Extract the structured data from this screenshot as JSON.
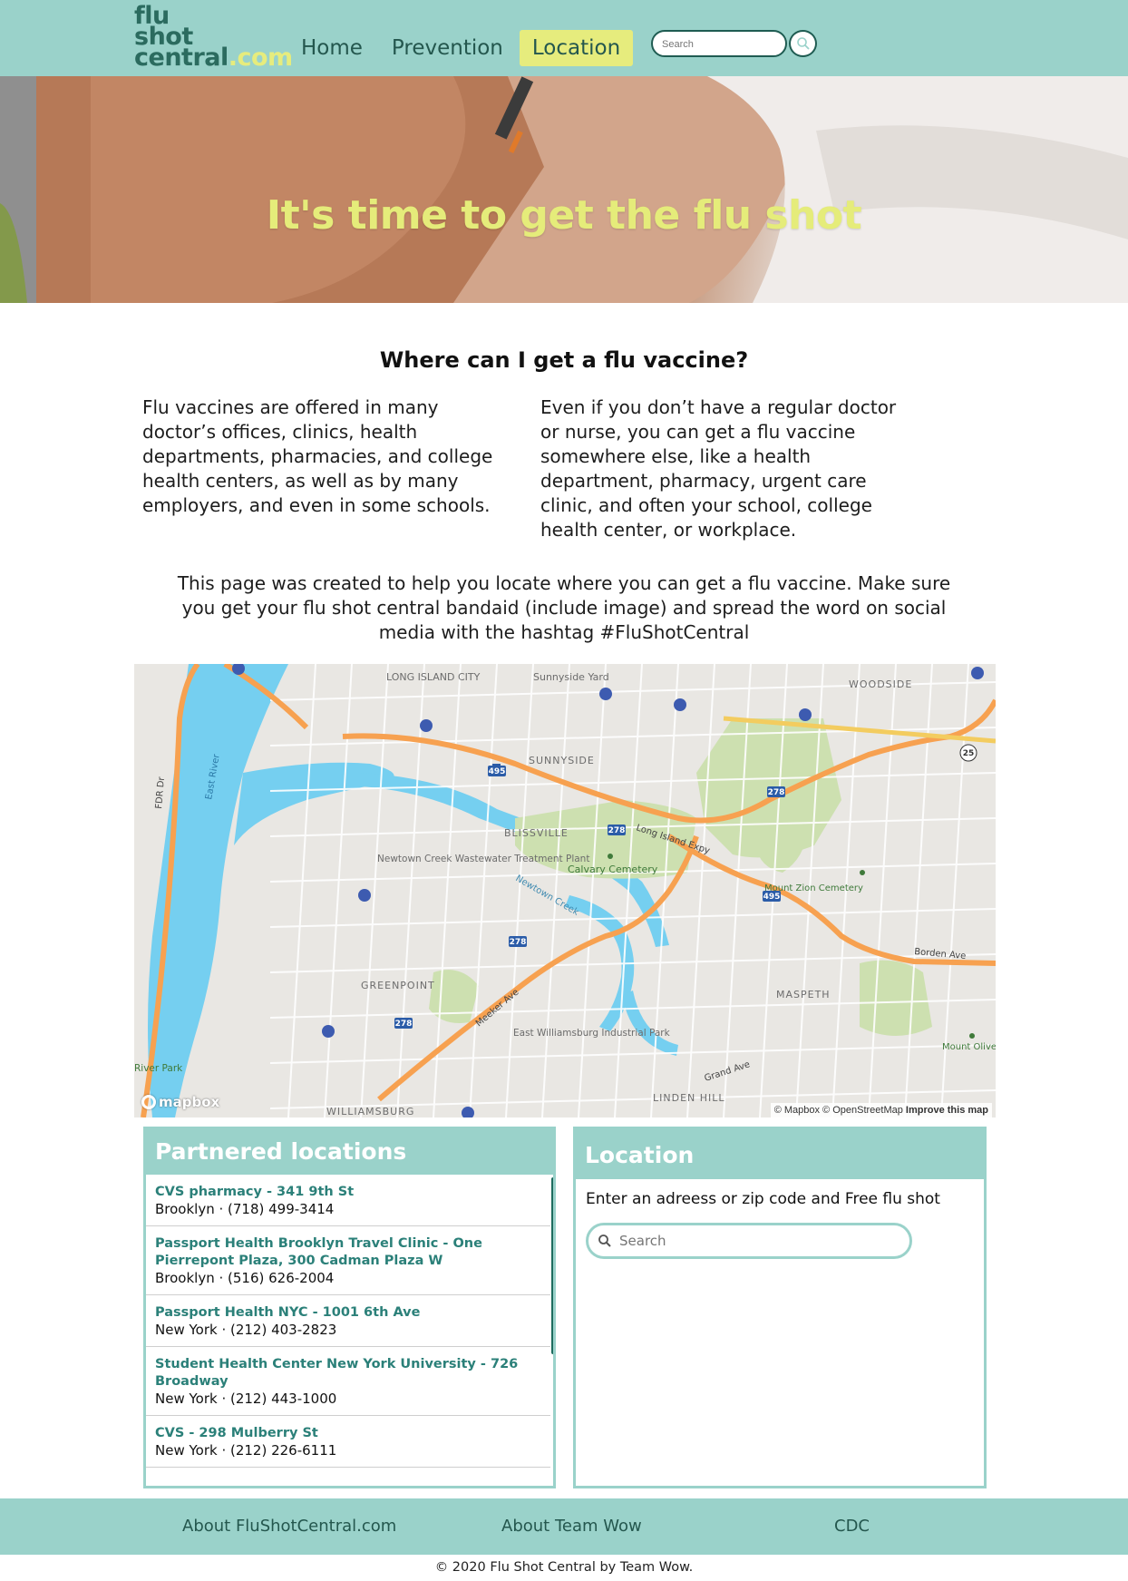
{
  "header": {
    "logo_line1": "flu",
    "logo_line2": "shot",
    "logo_line3": "central",
    "logo_suffix": ".com",
    "nav": [
      {
        "label": "Home"
      },
      {
        "label": "Prevention"
      },
      {
        "label": "Location",
        "active": true
      }
    ],
    "search_placeholder": "Search",
    "search_icon": "magnifier-icon"
  },
  "hero": {
    "title": "It's time to get the flu shot"
  },
  "main": {
    "section_title": "Where can I get a flu vaccine?",
    "col_left": "Flu vaccines are offered in many doctor’s offices, clinics, health departments, pharmacies, and college health centers, as well as by many employers, and even in some schools.",
    "col_right": "Even if you don’t have a regular doctor or nurse, you can get a flu vaccine somewhere else, like a health department, pharmacy, urgent care clinic, and often your school, college health center, or workplace.",
    "intro": "This page was created to help you locate where you can get a flu vaccine. Make sure you get your flu shot central bandaid (include image) and spread the word on social media with the hashtag #FluShotCentral"
  },
  "map": {
    "logo": "mapbox",
    "attribution": "© Mapbox © OpenStreetMap",
    "improve": "Improve this map",
    "labels": {
      "lic": "LONG ISLAND CITY",
      "sunnyside_yard": "Sunnyside Yard",
      "woodside": "WOODSIDE",
      "sunnyside": "SUNNYSIDE",
      "blissville": "BLISSVILLE",
      "newtown": "Newtown Creek Wastewater Treatment Plant",
      "calvary": "Calvary Cemetery",
      "mount_zion": "Mount Zion Cemetery",
      "greenpoint": "GREENPOINT",
      "maspeth": "MASPETH",
      "ewip": "East Williamsburg Industrial Park",
      "linden_hill": "LINDEN HILL",
      "williamsburg": "WILLIAMSBURG",
      "east_river": "East River",
      "river_park": "River Park",
      "mount_olivet": "Mount Olivet Cemetery",
      "lie": "Long Island Expy",
      "newtown_creek": "Newtown Creek",
      "meeker": "Meeker Ave",
      "fdr": "FDR Dr",
      "borden": "Borden Ave",
      "grand": "Grand Ave",
      "shields": [
        "495",
        "278",
        "278",
        "278",
        "495",
        "278",
        "25"
      ]
    }
  },
  "partnered": {
    "title": "Partnered locations",
    "items": [
      {
        "name": "CVS pharmacy - 341 9th St",
        "meta": "Brooklyn · (718) 499-3414"
      },
      {
        "name": "Passport Health Brooklyn Travel Clinic - One Pierrepont Plaza, 300 Cadman Plaza W",
        "meta": "Brooklyn · (516) 626-2004"
      },
      {
        "name": "Passport Health NYC - 1001 6th Ave",
        "meta": "New York · (212) 403-2823"
      },
      {
        "name": "Student Health Center New York University - 726 Broadway",
        "meta": "New York · (212) 443-1000"
      },
      {
        "name": "CVS - 298 Mulberry St",
        "meta": "New York · (212) 226-6111"
      }
    ]
  },
  "location": {
    "title": "Location",
    "prompt": "Enter an adreess or zip code and Free flu shot",
    "search_placeholder": "Search"
  },
  "footer": {
    "links": [
      "About FluShotCentral.com",
      "About Team Wow",
      "CDC"
    ],
    "copyright": "© 2020 Flu Shot Central by Team Wow."
  },
  "colors": {
    "brand_teal": "#9ad2ca",
    "accent_yellow": "#e6ec7d",
    "link_green": "#2b8079"
  }
}
